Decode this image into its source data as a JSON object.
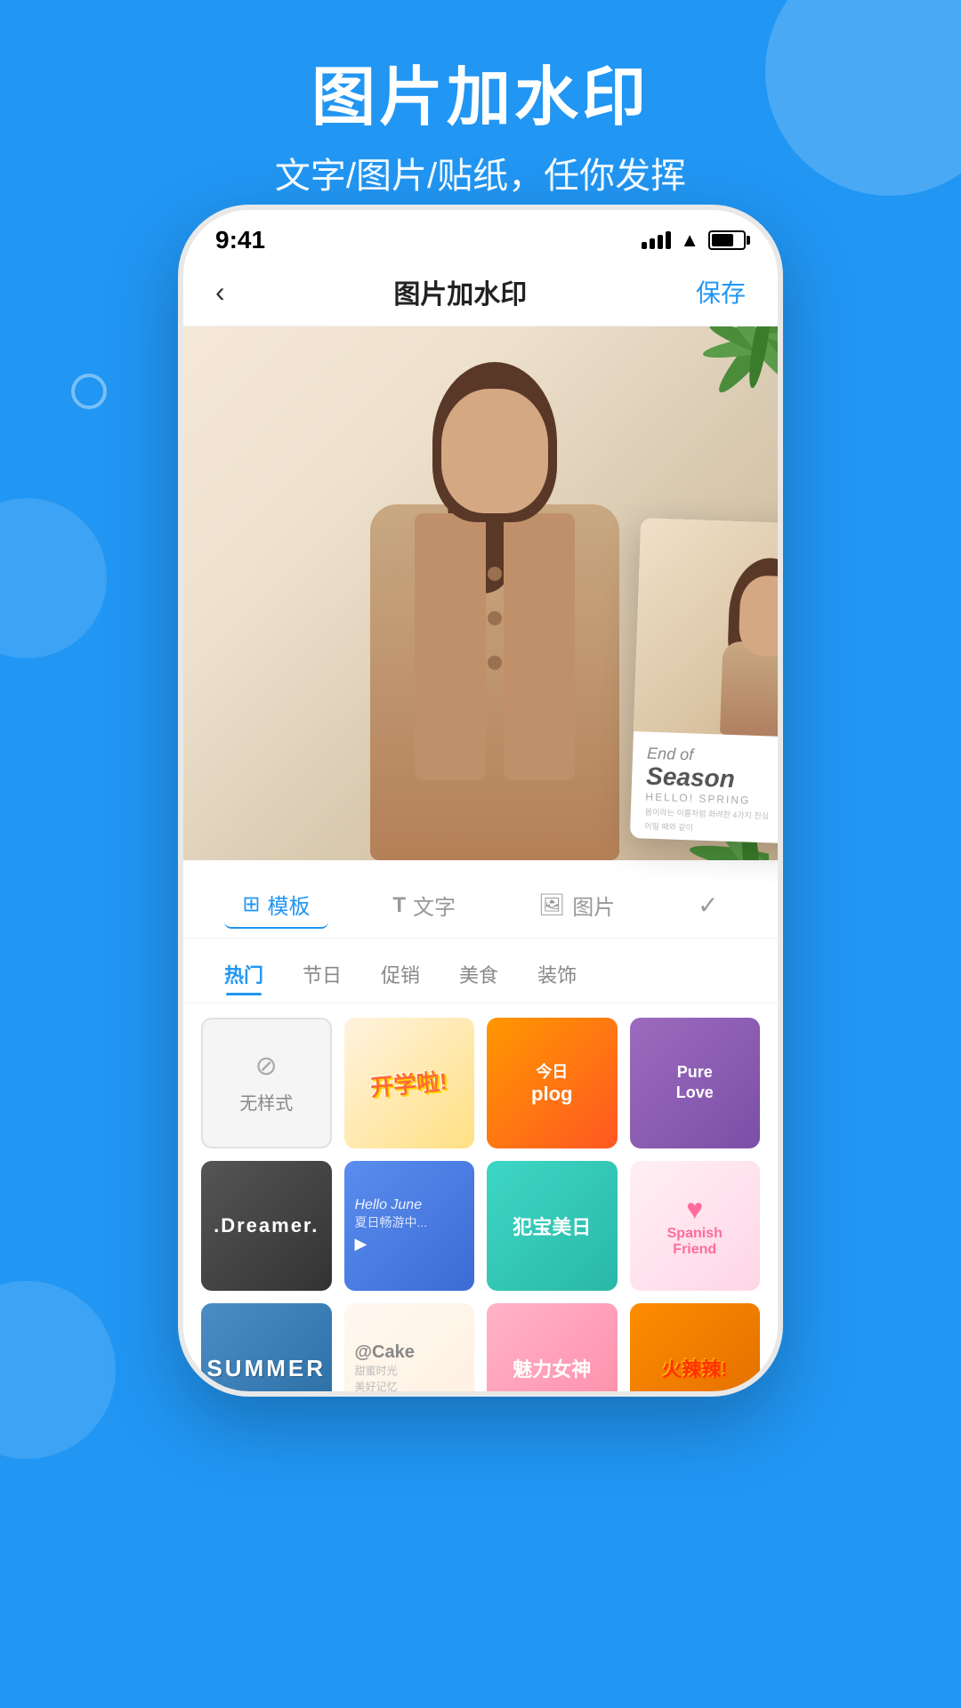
{
  "background_color": "#2196F3",
  "header": {
    "title": "图片加水印",
    "subtitle": "文字/图片/贴纸，任你发挥"
  },
  "status_bar": {
    "time": "9:41"
  },
  "app_bar": {
    "back_label": "‹",
    "title": "图片加水印",
    "save_label": "保存"
  },
  "tabs": [
    {
      "id": "template",
      "icon": "⊞",
      "label": "模板",
      "active": true
    },
    {
      "id": "text",
      "icon": "T",
      "label": "文字",
      "active": false
    },
    {
      "id": "image",
      "icon": "🖼",
      "label": "图片",
      "active": false
    },
    {
      "id": "check",
      "icon": "✓",
      "label": "",
      "active": false
    }
  ],
  "categories": [
    {
      "id": "hot",
      "label": "热门",
      "active": true
    },
    {
      "id": "holiday",
      "label": "节日",
      "active": false
    },
    {
      "id": "sale",
      "label": "促销",
      "active": false
    },
    {
      "id": "food",
      "label": "美食",
      "active": false
    },
    {
      "id": "decor",
      "label": "装饰",
      "active": false
    }
  ],
  "templates": [
    {
      "id": "no-style",
      "type": "no-style",
      "label": "无样式"
    },
    {
      "id": "kaixin",
      "type": "kaixin",
      "label": "开学啦"
    },
    {
      "id": "plog",
      "type": "plog",
      "label": "今日plog"
    },
    {
      "id": "purelove",
      "type": "purelove",
      "label": "PureLove"
    },
    {
      "id": "dreamer",
      "type": "dreamer",
      "label": "Dreamer"
    },
    {
      "id": "hellojune",
      "type": "hellojune",
      "label": "Hello June 夏日"
    },
    {
      "id": "baobeimei",
      "type": "baobeimei",
      "label": "犯宝美日"
    },
    {
      "id": "spanish",
      "type": "spanish",
      "label": "Spanish Friend"
    },
    {
      "id": "summer",
      "type": "summer",
      "label": "SUMMER"
    },
    {
      "id": "cake",
      "type": "cake",
      "label": "@Cake"
    },
    {
      "id": "meili",
      "type": "meili",
      "label": "魅力女神"
    },
    {
      "id": "huola",
      "type": "huola",
      "label": "火辣辣"
    }
  ],
  "preview_card": {
    "end_text": "End of",
    "season_text": "Season",
    "hello_text": "HELLO! SPRING",
    "small_text1": "봄이라는 이름처럼 화려한 4가지 진심",
    "small_text2": "어릴 때와 같이"
  }
}
